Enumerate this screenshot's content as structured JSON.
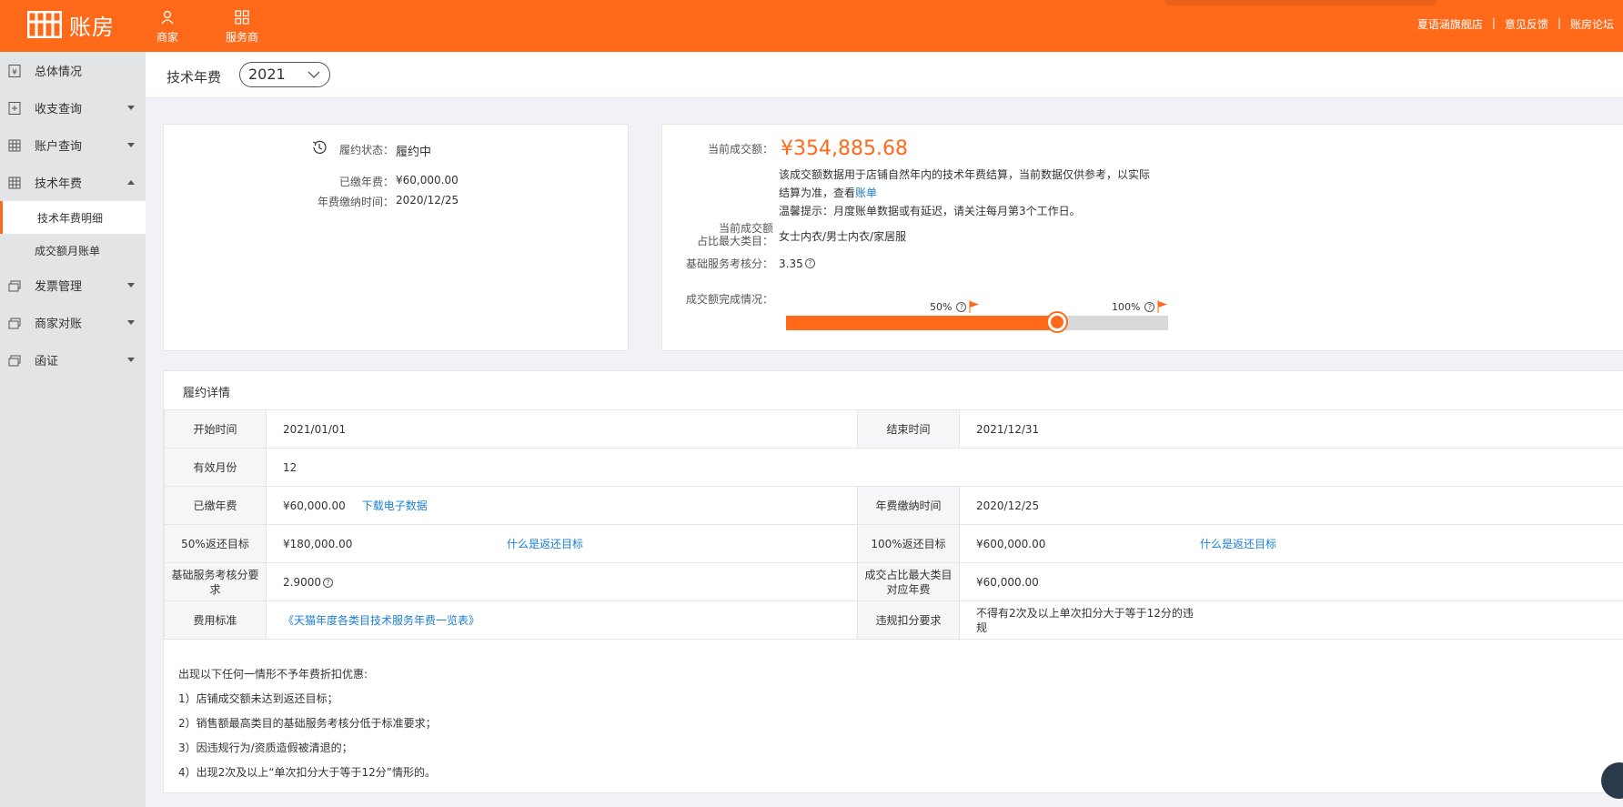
{
  "app": {
    "logo_text": "账房",
    "nav": [
      {
        "label": "商家",
        "icon": "user-icon"
      },
      {
        "label": "服务商",
        "icon": "grid-icon"
      }
    ],
    "links": [
      "夏语涵旗舰店",
      "意见反馈",
      "账房论坛"
    ]
  },
  "sidebar": {
    "items": [
      {
        "label": "总体情况",
        "icon": "yen-doc-icon"
      },
      {
        "label": "收支查询",
        "icon": "plus-doc-icon"
      },
      {
        "label": "账户查询",
        "icon": "table-icon"
      },
      {
        "label": "技术年费",
        "icon": "table-icon"
      },
      {
        "label": "发票管理",
        "icon": "stack-icon"
      },
      {
        "label": "商家对账",
        "icon": "stack-icon"
      },
      {
        "label": "函证",
        "icon": "stack-icon"
      }
    ],
    "sub_items": [
      "技术年费明细",
      "成交额月账单"
    ]
  },
  "header": {
    "title": "技术年费",
    "year": "2021"
  },
  "status_card": {
    "status_label": "履约状态：",
    "status_value": "履约中",
    "paid_label": "已缴年费：",
    "paid_value": "¥60,000.00",
    "paytime_label": "年费缴纳时间：",
    "paytime_value": "2020/12/25"
  },
  "summary_card": {
    "amount_label": "当前成交额：",
    "amount_value": "¥354,885.68",
    "desc_line1": "该成交额数据用于店铺自然年内的技术年费结算，当前数据仅供参考，以实际",
    "desc_line2_prefix": "结算为准，查看",
    "desc_link": "账单",
    "tip": "温馨提示：月度账单数据或有延迟，请关注每月第3个工作日。",
    "category_label_1": "当前成交额",
    "category_label_2": "占比最大类目：",
    "category_value": "女士内衣/男士内衣/家居服",
    "score_label": "基础服务考核分：",
    "score_value": "3.35",
    "progress_label": "成交额完成情况：",
    "mark_50": "50%",
    "mark_100": "100%",
    "progress_fraction": 0.709
  },
  "detail": {
    "title": "履约详情",
    "rows": [
      {
        "l1": "开始时间",
        "v1": "2021/01/01",
        "l2": "结束时间",
        "v2": "2021/12/31"
      },
      {
        "l1": "有效月份",
        "v1": "12"
      },
      {
        "l1": "已缴年费",
        "v1": "¥60,000.00",
        "v1_link": "下载电子数据",
        "l2": "年费缴纳时间",
        "v2": "2020/12/25"
      },
      {
        "l1": "50%返还目标",
        "v1": "¥180,000.00",
        "v1_link": "什么是返还目标",
        "l2": "100%返还目标",
        "v2": "¥600,000.00",
        "v2_link": "什么是返还目标"
      },
      {
        "l1": "基础服务考核分要求",
        "v1": "2.9000",
        "l2": "成交占比最大类目对应年费",
        "v2": "¥60,000.00"
      },
      {
        "l1": "费用标准",
        "v1_link": "《天猫年度各类目技术服务年费一览表》",
        "l2": "违规扣分要求",
        "v2": "不得有2次及以上单次扣分大于等于12分的违规"
      }
    ],
    "notes": [
      "出现以下任何一情形不予年费折扣优惠:",
      "1）店铺成交额未达到返还目标；",
      "2）销售额最高类目的基础服务考核分低于标准要求；",
      "3）因违规行为/资质造假被清退的；",
      "4）出现2次及以上“单次扣分大于等于12分”情形的。"
    ]
  }
}
